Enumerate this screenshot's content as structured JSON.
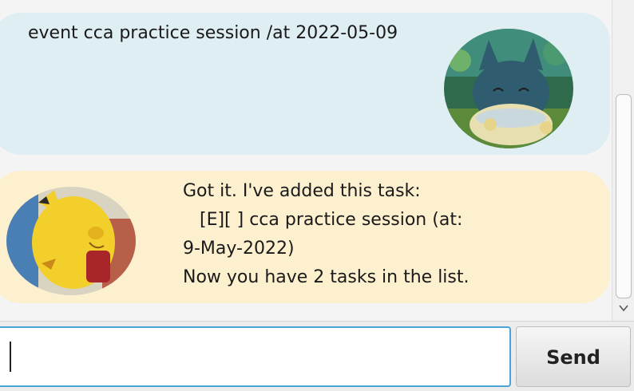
{
  "conversation": {
    "messages": [
      {
        "sender": "user",
        "text": "event cca practice session /at 2022-05-09"
      },
      {
        "sender": "bot",
        "text": "Got it. I've added this task:\n   [E][ ] cca practice session (at:\n9-May-2022)\nNow you have 2 tasks in the list."
      }
    ]
  },
  "input": {
    "value": "",
    "placeholder": ""
  },
  "send_button": {
    "label": "Send"
  },
  "colors": {
    "user_bubble": "#deeef2",
    "bot_bubble": "#fdf0cf",
    "input_focus_border": "#4aa4d8"
  },
  "icons": {
    "user_avatar": "munchlax-avatar-icon",
    "bot_avatar": "pikachu-avatar-icon",
    "scroll_down": "chevron-down-icon"
  }
}
